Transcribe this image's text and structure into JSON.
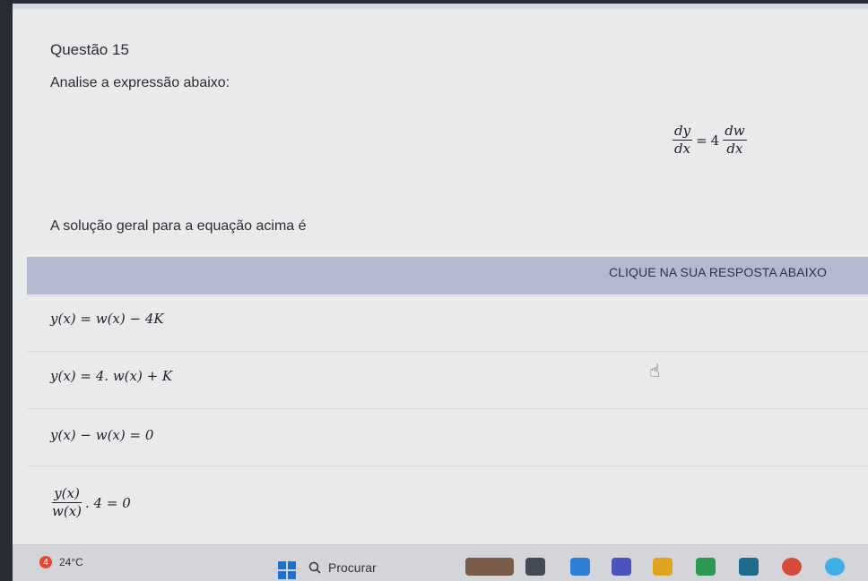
{
  "question": {
    "title": "Questão 15",
    "intro": "Analise a expressão abaixo:",
    "formula": {
      "lhs_num": "dy",
      "lhs_den": "dx",
      "equals": "=",
      "coef": "4",
      "rhs_num": "dw",
      "rhs_den": "dx"
    },
    "prompt": "A solução geral para a equação acima é"
  },
  "banner": {
    "label": "CLIQUE NA SUA RESPOSTA ABAIXO"
  },
  "options": [
    {
      "text": "y(x) = w(x) − 4K"
    },
    {
      "text": "y(x) = 4. w(x) + K"
    },
    {
      "text": "y(x) − w(x) = 0"
    },
    {
      "num": "y(x)",
      "den": "w(x)",
      "rest": ". 4 = 0"
    }
  ],
  "taskbar": {
    "weather_badge": "4",
    "temperature": "24°C",
    "search_placeholder": "Procurar"
  },
  "colors": {
    "banner": "#b3bad0",
    "windows_blue": "#1e6fd1",
    "badge": "#e04a2f"
  }
}
